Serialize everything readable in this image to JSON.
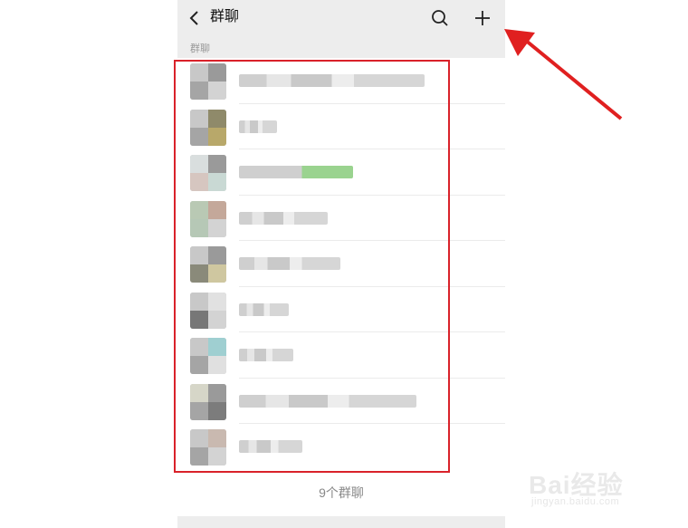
{
  "header": {
    "title": "群聊",
    "back_icon": "chevron-left-icon",
    "search_icon": "search-icon",
    "add_icon": "plus-icon"
  },
  "section": {
    "label": "群聊"
  },
  "groups": [
    {
      "name_blurred": true,
      "green": false
    },
    {
      "name_blurred": true,
      "green": false
    },
    {
      "name_blurred": true,
      "green": true
    },
    {
      "name_blurred": true,
      "green": false
    },
    {
      "name_blurred": true,
      "green": false
    },
    {
      "name_blurred": true,
      "green": false
    },
    {
      "name_blurred": true,
      "green": false
    },
    {
      "name_blurred": true,
      "green": false
    },
    {
      "name_blurred": true,
      "green": false
    }
  ],
  "footer": {
    "count_text": "9个群聊"
  },
  "annotation": {
    "highlight_color": "#d9222a",
    "arrow_color": "#e02020"
  },
  "watermark": {
    "main": "Bai经验",
    "sub": "jingyan.baidu.com"
  }
}
